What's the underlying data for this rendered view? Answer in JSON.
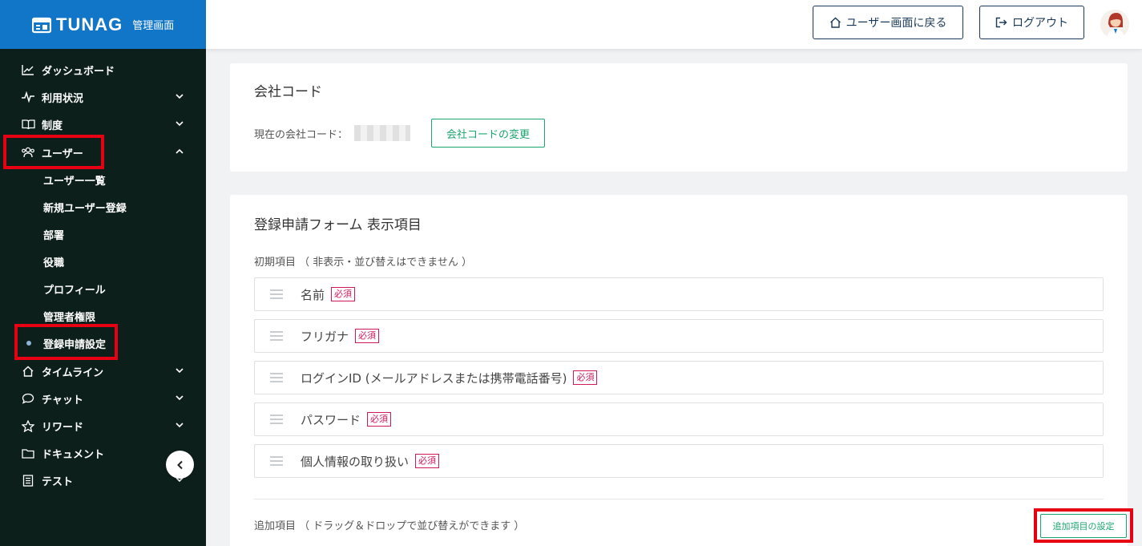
{
  "brand": {
    "name": "TUNAG",
    "sub": "管理画面"
  },
  "sidebar": {
    "items": [
      {
        "label": "ダッシュボード",
        "icon": "chart-icon"
      },
      {
        "label": "利用状況",
        "icon": "pulse-icon"
      },
      {
        "label": "制度",
        "icon": "book-icon"
      },
      {
        "label": "ユーザー",
        "icon": "users-icon"
      }
    ],
    "user_sub": [
      {
        "label": "ユーザー一覧"
      },
      {
        "label": "新規ユーザー登録"
      },
      {
        "label": "部署"
      },
      {
        "label": "役職"
      },
      {
        "label": "プロフィール"
      },
      {
        "label": "管理者権限"
      },
      {
        "label": "登録申請設定"
      }
    ],
    "items_after": [
      {
        "label": "タイムライン",
        "icon": "home-icon"
      },
      {
        "label": "チャット",
        "icon": "chat-bubble-icon"
      },
      {
        "label": "リワード",
        "icon": "star-icon"
      },
      {
        "label": "ドキュメント",
        "icon": "folder-icon"
      },
      {
        "label": "テスト",
        "icon": "list-icon"
      }
    ]
  },
  "header": {
    "back_label": "ユーザー画面に戻る",
    "logout_label": "ログアウト"
  },
  "company_code": {
    "title": "会社コード",
    "current_label": "現在の会社コード：",
    "change_label": "会社コードの変更"
  },
  "form_section": {
    "title": "登録申請フォーム 表示項目",
    "initial_label": "初期項目 （ 非表示・並び替えはできません ）",
    "required_badge": "必須",
    "fields": [
      {
        "label": "名前"
      },
      {
        "label": "フリガナ"
      },
      {
        "label": "ログインID (メールアドレスまたは携帯電話番号)"
      },
      {
        "label": "パスワード"
      },
      {
        "label": "個人情報の取り扱い"
      }
    ],
    "additional_label": "追加項目 （ ドラッグ＆ドロップで並び替えができます ）",
    "additional_button": "追加項目の設定"
  },
  "colors": {
    "sidebar_bg": "#0d1f1a",
    "brand_bg": "#1176c7",
    "accent_green": "#1aa56e",
    "required_red": "#d0195b",
    "highlight_red": "#e60012"
  }
}
